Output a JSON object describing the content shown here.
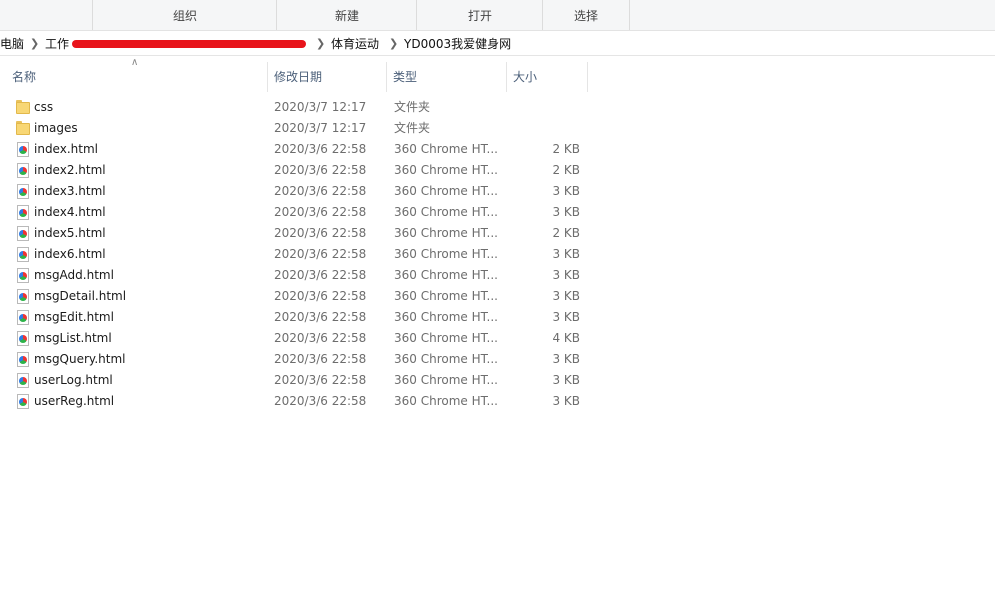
{
  "ribbon": {
    "groups": [
      "组织",
      "新建",
      "打开",
      "选择"
    ]
  },
  "breadcrumb": {
    "items": [
      "电脑",
      "工作",
      "体育运动",
      "YD0003我爱健身网"
    ]
  },
  "columns": {
    "name": "名称",
    "date": "修改日期",
    "type": "类型",
    "size": "大小"
  },
  "files": [
    {
      "name": "css",
      "date": "2020/3/7 12:17",
      "type": "文件夹",
      "size": "",
      "kind": "folder"
    },
    {
      "name": "images",
      "date": "2020/3/7 12:17",
      "type": "文件夹",
      "size": "",
      "kind": "folder"
    },
    {
      "name": "index.html",
      "date": "2020/3/6 22:58",
      "type": "360 Chrome HT...",
      "size": "2 KB",
      "kind": "html"
    },
    {
      "name": "index2.html",
      "date": "2020/3/6 22:58",
      "type": "360 Chrome HT...",
      "size": "2 KB",
      "kind": "html"
    },
    {
      "name": "index3.html",
      "date": "2020/3/6 22:58",
      "type": "360 Chrome HT...",
      "size": "3 KB",
      "kind": "html"
    },
    {
      "name": "index4.html",
      "date": "2020/3/6 22:58",
      "type": "360 Chrome HT...",
      "size": "3 KB",
      "kind": "html"
    },
    {
      "name": "index5.html",
      "date": "2020/3/6 22:58",
      "type": "360 Chrome HT...",
      "size": "2 KB",
      "kind": "html"
    },
    {
      "name": "index6.html",
      "date": "2020/3/6 22:58",
      "type": "360 Chrome HT...",
      "size": "3 KB",
      "kind": "html"
    },
    {
      "name": "msgAdd.html",
      "date": "2020/3/6 22:58",
      "type": "360 Chrome HT...",
      "size": "3 KB",
      "kind": "html"
    },
    {
      "name": "msgDetail.html",
      "date": "2020/3/6 22:58",
      "type": "360 Chrome HT...",
      "size": "3 KB",
      "kind": "html"
    },
    {
      "name": "msgEdit.html",
      "date": "2020/3/6 22:58",
      "type": "360 Chrome HT...",
      "size": "3 KB",
      "kind": "html"
    },
    {
      "name": "msgList.html",
      "date": "2020/3/6 22:58",
      "type": "360 Chrome HT...",
      "size": "4 KB",
      "kind": "html"
    },
    {
      "name": "msgQuery.html",
      "date": "2020/3/6 22:58",
      "type": "360 Chrome HT...",
      "size": "3 KB",
      "kind": "html"
    },
    {
      "name": "userLog.html",
      "date": "2020/3/6 22:58",
      "type": "360 Chrome HT...",
      "size": "3 KB",
      "kind": "html"
    },
    {
      "name": "userReg.html",
      "date": "2020/3/6 22:58",
      "type": "360 Chrome HT...",
      "size": "3 KB",
      "kind": "html"
    }
  ],
  "colors": {
    "folder": "#f8d775",
    "header_text": "#4c607a",
    "redaction": "#e8141b"
  }
}
